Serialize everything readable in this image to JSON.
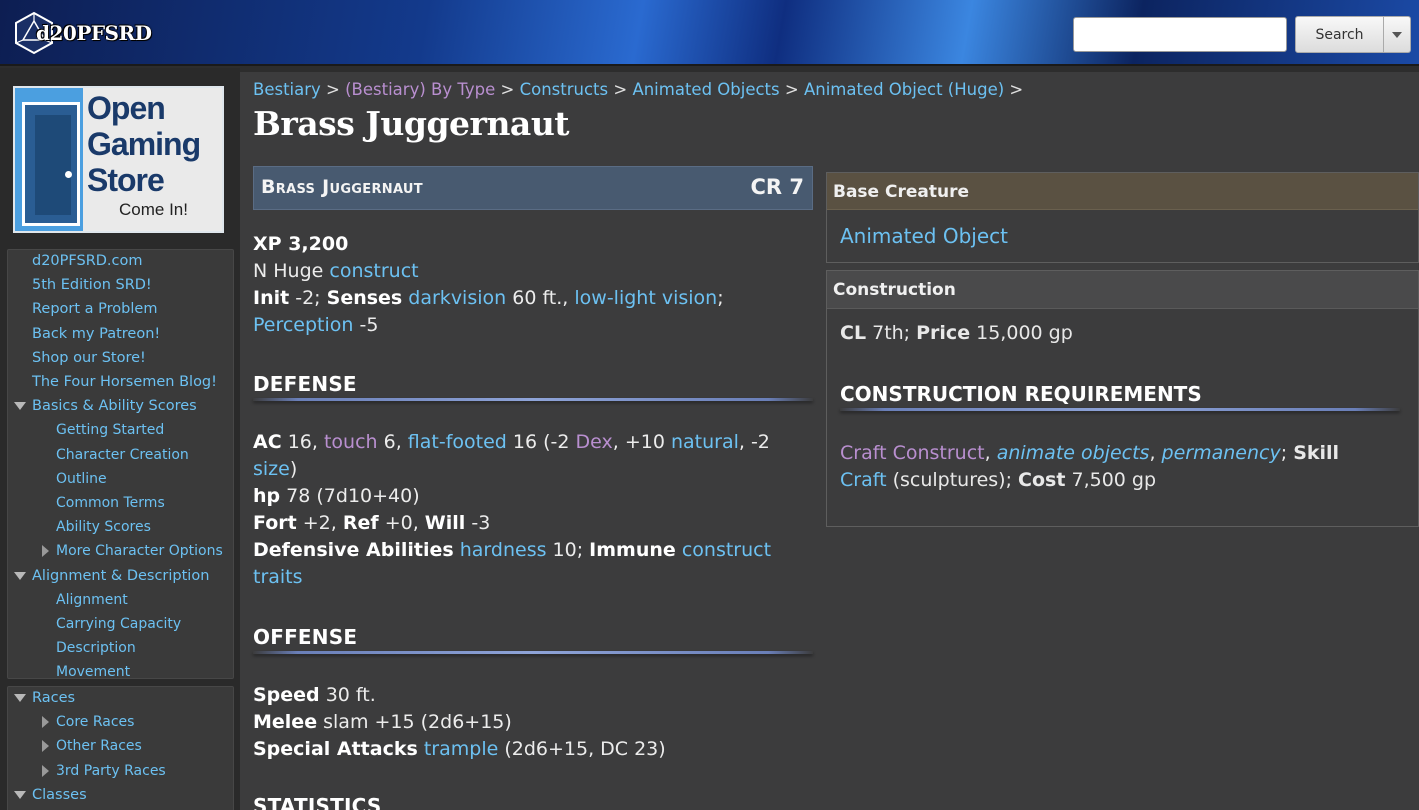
{
  "header": {
    "logo_text": "d20PFSRD",
    "search": {
      "placeholder": "",
      "value": ""
    },
    "search_button_label": "Search",
    "colors": {
      "accent": "#2a6ad0"
    }
  },
  "sidebar": {
    "ad": {
      "lines": [
        "Open",
        "Gaming",
        "Store"
      ],
      "cta": "Come In!"
    },
    "nav_main": [
      {
        "label": "d20PFSRD.com",
        "level": 0,
        "toggle": "none"
      },
      {
        "label": "5th Edition SRD!",
        "level": 0,
        "toggle": "none"
      },
      {
        "label": "Report a Problem",
        "level": 0,
        "toggle": "none"
      },
      {
        "label": "Back my Patreon!",
        "level": 0,
        "toggle": "none"
      },
      {
        "label": "Shop our Store!",
        "level": 0,
        "toggle": "none"
      },
      {
        "label": "The Four Horsemen Blog!",
        "level": 0,
        "toggle": "none"
      },
      {
        "label": "Basics & Ability Scores",
        "level": 0,
        "toggle": "open"
      },
      {
        "label": "Getting Started",
        "level": 1,
        "toggle": "none"
      },
      {
        "label": "Character Creation",
        "level": 1,
        "toggle": "none"
      },
      {
        "label": "Outline",
        "level": 1,
        "toggle": "none"
      },
      {
        "label": "Common Terms",
        "level": 1,
        "toggle": "none"
      },
      {
        "label": "Ability Scores",
        "level": 1,
        "toggle": "none"
      },
      {
        "label": "More Character Options",
        "level": 1,
        "toggle": "closed"
      },
      {
        "label": "Alignment & Description",
        "level": 0,
        "toggle": "open"
      },
      {
        "label": "Alignment",
        "level": 1,
        "toggle": "none"
      },
      {
        "label": "Carrying Capacity",
        "level": 1,
        "toggle": "none"
      },
      {
        "label": "Description",
        "level": 1,
        "toggle": "none"
      },
      {
        "label": "Movement",
        "level": 1,
        "toggle": "none"
      }
    ],
    "nav_races": [
      {
        "label": "Races",
        "level": 0,
        "toggle": "open"
      },
      {
        "label": "Core Races",
        "level": 1,
        "toggle": "closed"
      },
      {
        "label": "Other Races",
        "level": 1,
        "toggle": "closed"
      },
      {
        "label": "3rd Party Races",
        "level": 1,
        "toggle": "closed"
      },
      {
        "label": "Classes",
        "level": 0,
        "toggle": "open"
      }
    ]
  },
  "breadcrumb": {
    "items": [
      "Bestiary",
      "(Bestiary) By Type",
      "Constructs",
      "Animated Objects",
      "Animated Object (Huge)"
    ],
    "separator": ">"
  },
  "page_title": "Brass Juggernaut",
  "statblock": {
    "name": "Brass Juggernaut",
    "cr": "CR 7",
    "xp": "XP 3,200",
    "type_line": {
      "prefix": "N Huge ",
      "type": "construct"
    },
    "init": {
      "label": "Init",
      "value": " -2; "
    },
    "senses": {
      "label": "Senses",
      "darkvision": "darkvision",
      "dv_range": " 60 ft., ",
      "lowlight": "low-light vision",
      "end": ";"
    },
    "perception": {
      "label": "Perception",
      "value": " -5"
    },
    "sections": {
      "defense": "DEFENSE",
      "offense": "OFFENSE",
      "statistics": "STATISTICS"
    },
    "ac": {
      "label": "AC",
      "v1": " 16, ",
      "touch": "touch",
      "v2": " 6, ",
      "flat": "flat-footed",
      "v3": " 16 (-2 ",
      "dex": "Dex",
      "v4": ", +10 ",
      "natural": "natural",
      "v5": ", -2",
      "size": "size",
      "v6": ")"
    },
    "hp": {
      "label": "hp",
      "value": " 78 (7d10+40)"
    },
    "saves": {
      "fort_label": "Fort",
      "fort": " +2, ",
      "ref_label": "Ref",
      "ref": " +0, ",
      "will_label": "Will",
      "will": " -3"
    },
    "defensive": {
      "label": "Defensive Abilities",
      "hardness": "hardness",
      "h_value": " 10; ",
      "immune_label": "Immune",
      "construct": "construct",
      "traits": "traits"
    },
    "speed": {
      "label": "Speed",
      "value": " 30 ft."
    },
    "melee": {
      "label": "Melee",
      "value": " slam +15 (2d6+15)"
    },
    "special": {
      "label": "Special Attacks",
      "trample": "trample",
      "value": " (2d6+15, DC 23)"
    }
  },
  "base_creature": {
    "title": "Base Creature",
    "link": "Animated Object"
  },
  "construction": {
    "title": "Construction",
    "cl_label": "CL",
    "cl_value": " 7th; ",
    "price_label": "Price",
    "price_value": " 15,000 gp",
    "req_heading": "CONSTRUCTION REQUIREMENTS",
    "craft_construct": "Craft Construct",
    "sep1": ", ",
    "animate": "animate objects",
    "sep2": ", ",
    "permanency": "permanency",
    "sep3": "; ",
    "skill_label": "Skill",
    "craft": "Craft",
    "craft_rest": " (sculptures); ",
    "cost_label": "Cost",
    "cost_value": " 7,500 gp"
  }
}
